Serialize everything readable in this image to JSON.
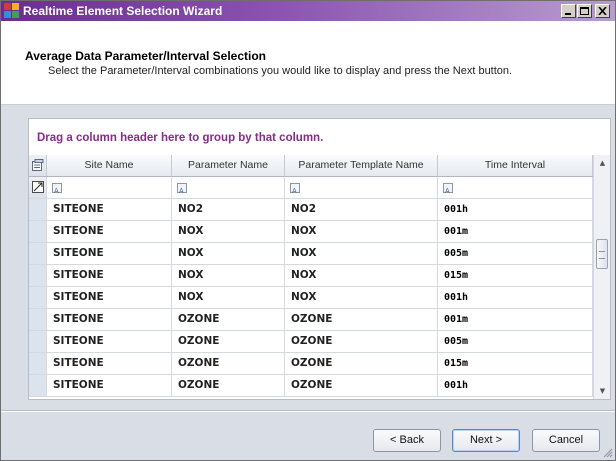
{
  "window": {
    "title": "Realtime Element Selection Wizard",
    "controls": [
      "minimize",
      "maximize",
      "close"
    ]
  },
  "header": {
    "title": "Average Data Parameter/Interval Selection",
    "description": "Select the Parameter/Interval combinations you would like to display and press the Next button."
  },
  "grid": {
    "group_panel_text": "Drag a column header here to group by that column.",
    "columns": [
      "Site Name",
      "Parameter Name",
      "Parameter Template Name",
      "Time Interval"
    ],
    "rows": [
      [
        "SITEONE",
        "NO2",
        "NO2",
        "001h"
      ],
      [
        "SITEONE",
        "NOX",
        "NOX",
        "001m"
      ],
      [
        "SITEONE",
        "NOX",
        "NOX",
        "005m"
      ],
      [
        "SITEONE",
        "NOX",
        "NOX",
        "015m"
      ],
      [
        "SITEONE",
        "NOX",
        "NOX",
        "001h"
      ],
      [
        "SITEONE",
        "OZONE",
        "OZONE",
        "001m"
      ],
      [
        "SITEONE",
        "OZONE",
        "OZONE",
        "005m"
      ],
      [
        "SITEONE",
        "OZONE",
        "OZONE",
        "015m"
      ],
      [
        "SITEONE",
        "OZONE",
        "OZONE",
        "001h"
      ]
    ]
  },
  "buttons": {
    "back": "< Back",
    "next": "Next >",
    "cancel": "Cancel"
  },
  "colors": {
    "title_bar": "#6a2d8f",
    "group_panel_text": "#8a2a8c",
    "row_selector": "#dbe3ef"
  }
}
